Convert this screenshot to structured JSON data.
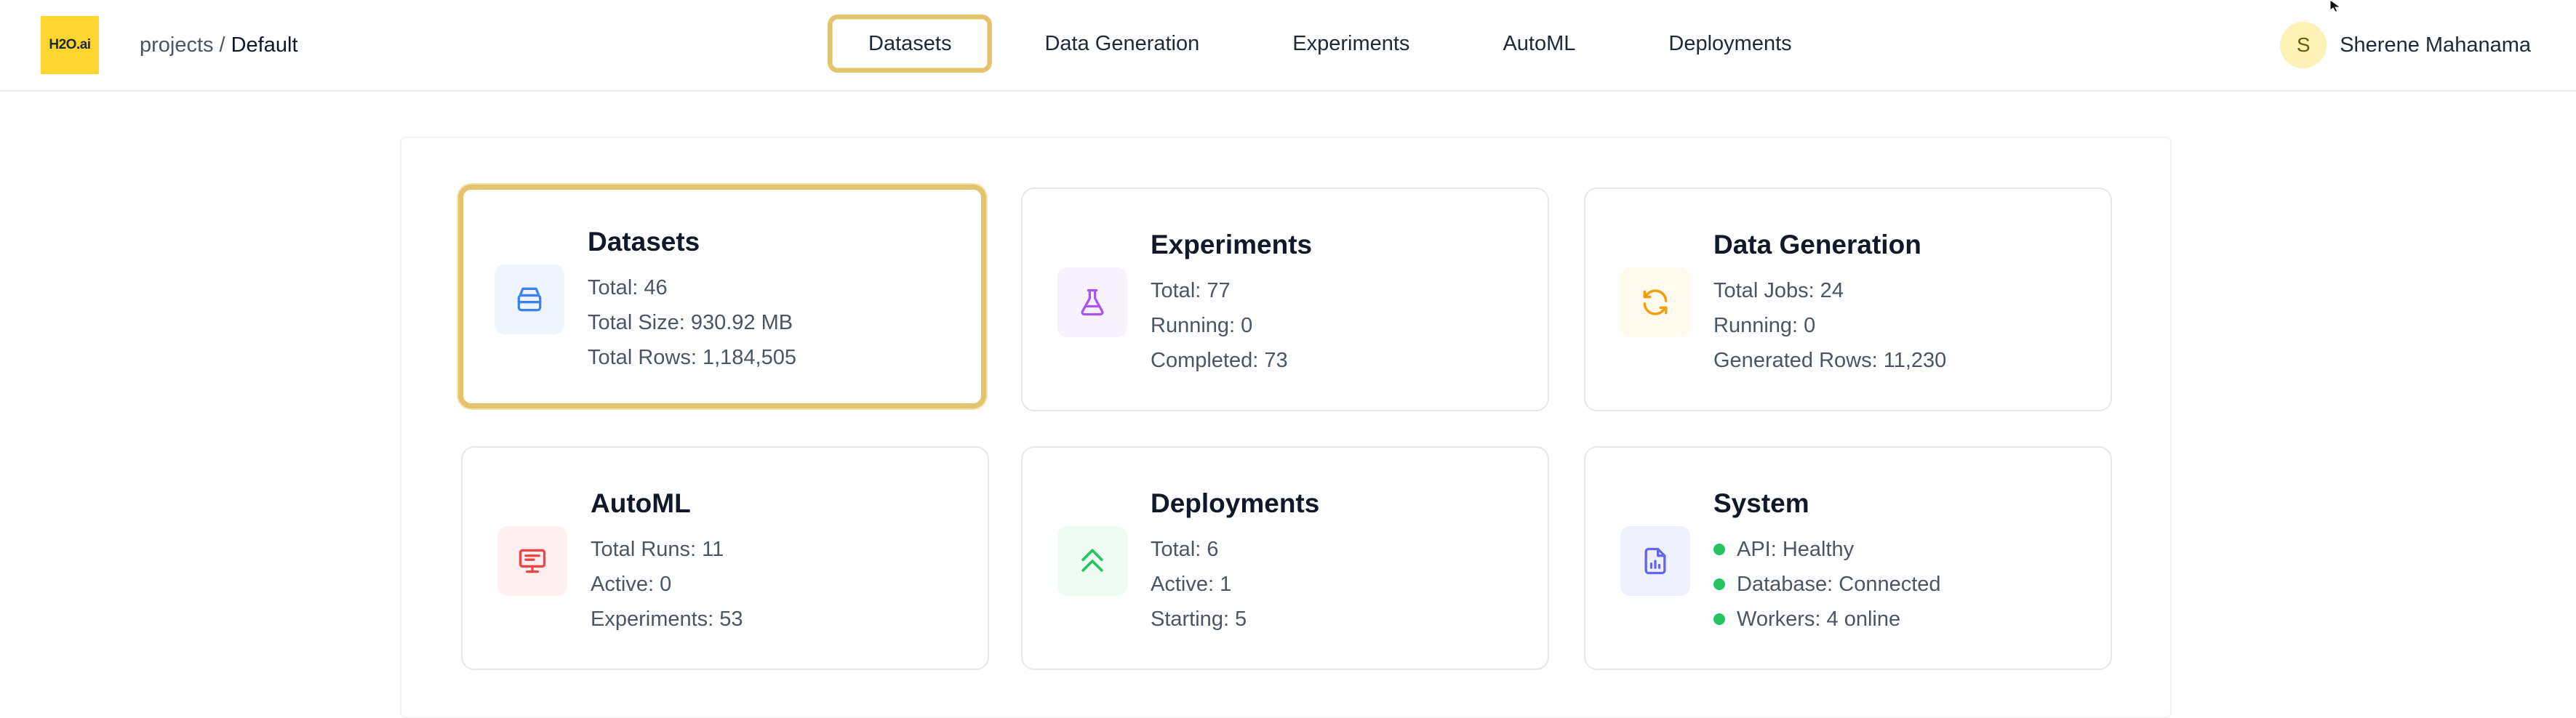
{
  "header": {
    "logo_text": "H2O.ai",
    "breadcrumb": {
      "root": "projects",
      "separator": "/",
      "current": "Default"
    },
    "nav": [
      {
        "label": "Datasets",
        "active": true
      },
      {
        "label": "Data Generation",
        "active": false
      },
      {
        "label": "Experiments",
        "active": false
      },
      {
        "label": "AutoML",
        "active": false
      },
      {
        "label": "Deployments",
        "active": false
      }
    ],
    "user": {
      "initial": "S",
      "name": "Sherene Mahanama"
    }
  },
  "cards": {
    "datasets": {
      "title": "Datasets",
      "icon": "database-icon",
      "lines": [
        "Total: 46",
        "Total Size: 930.92 MB",
        "Total Rows: 1,184,505"
      ]
    },
    "experiments": {
      "title": "Experiments",
      "icon": "flask-icon",
      "lines": [
        "Total: 77",
        "Running: 0",
        "Completed: 73"
      ]
    },
    "data_generation": {
      "title": "Data Generation",
      "icon": "refresh-icon",
      "lines": [
        "Total Jobs: 24",
        "Running: 0",
        "Generated Rows: 11,230"
      ]
    },
    "automl": {
      "title": "AutoML",
      "icon": "monitor-icon",
      "lines": [
        "Total Runs: 11",
        "Active: 0",
        "Experiments: 53"
      ]
    },
    "deployments": {
      "title": "Deployments",
      "icon": "chevrons-up-icon",
      "lines": [
        "Total: 6",
        "Active: 1",
        "Starting: 5"
      ]
    },
    "system": {
      "title": "System",
      "icon": "chart-document-icon",
      "lines": [
        "API: Healthy",
        "Database: Connected",
        "Workers: 4 online"
      ]
    }
  },
  "colors": {
    "accent_yellow": "#fdd52f",
    "active_border": "#e3c46b",
    "datasets_icon": "#3b82f6",
    "experiments_icon": "#a855f7",
    "data_generation_icon": "#f59e0b",
    "automl_icon": "#ef4444",
    "deployments_icon": "#22c55e",
    "system_icon": "#6366f1",
    "status_ok": "#22c55e"
  }
}
